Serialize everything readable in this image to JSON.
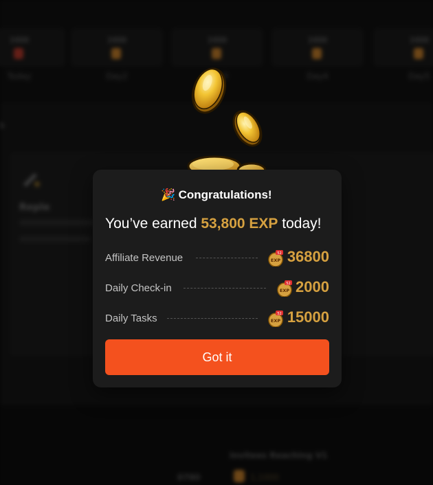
{
  "background": {
    "stat_cards": [
      {
        "value": "1000",
        "label": "Today"
      },
      {
        "value": "1000",
        "label": "Day2"
      },
      {
        "value": "1000",
        "label": "Day3"
      },
      {
        "value": "1000",
        "label": "Day4"
      },
      {
        "value": "1000",
        "label": "Day5"
      }
    ],
    "section_heading": "k",
    "referral_title": "Reple",
    "reach_text": "Invitees Reaching V1",
    "count_text": "0780",
    "reward_text": "1,1000"
  },
  "modal": {
    "title": "Congratulations!",
    "title_emoji": "🎉",
    "headline_prefix": "You’ve earned ",
    "headline_amount": "53,800 EXP",
    "headline_suffix": " today!",
    "badge_text": "EXP",
    "badge_tag": "52",
    "rows": [
      {
        "label": "Affiliate Revenue",
        "value": "36800"
      },
      {
        "label": "Daily Check-in",
        "value": "2000"
      },
      {
        "label": "Daily Tasks",
        "value": "15000"
      }
    ],
    "button_label": "Got it"
  },
  "colors": {
    "accent_orange": "#f4511e",
    "gold": "#d6a140",
    "modal_bg": "#1c1c1c"
  },
  "icons": [
    "party-popper-icon",
    "gold-coin-icon",
    "exp-badge-icon"
  ]
}
